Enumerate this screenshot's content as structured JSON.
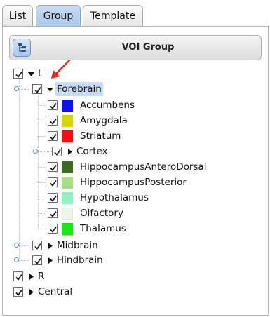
{
  "tabs": [
    {
      "label": "List"
    },
    {
      "label": "Group"
    },
    {
      "label": "Template"
    }
  ],
  "header": {
    "title": "VOI Group"
  },
  "tree": {
    "L": "L",
    "forebrain": "Forebrain",
    "accumbens": "Accumbens",
    "amygdala": "Amygdala",
    "striatum": "Striatum",
    "cortex": "Cortex",
    "hippo_ad": "HippocampusAnteroDorsal",
    "hippo_p": "HippocampusPosterior",
    "hypothalamus": "Hypothalamus",
    "olfactory": "Olfactory",
    "thalamus": "Thalamus",
    "midbrain": "Midbrain",
    "hindbrain": "Hindbrain",
    "R": "R",
    "central": "Central"
  },
  "colors": {
    "accumbens": "#1010ee",
    "amygdala": "#d6d600",
    "striatum": "#ee1111",
    "hippo_ad": "#3d6b22",
    "hippo_p": "#a7df8c",
    "hypothalamus": "#8ff2c0",
    "olfactory": "#ecf6e6",
    "thalamus": "#1ce51c",
    "annotation_arrow": "#e8261f"
  }
}
